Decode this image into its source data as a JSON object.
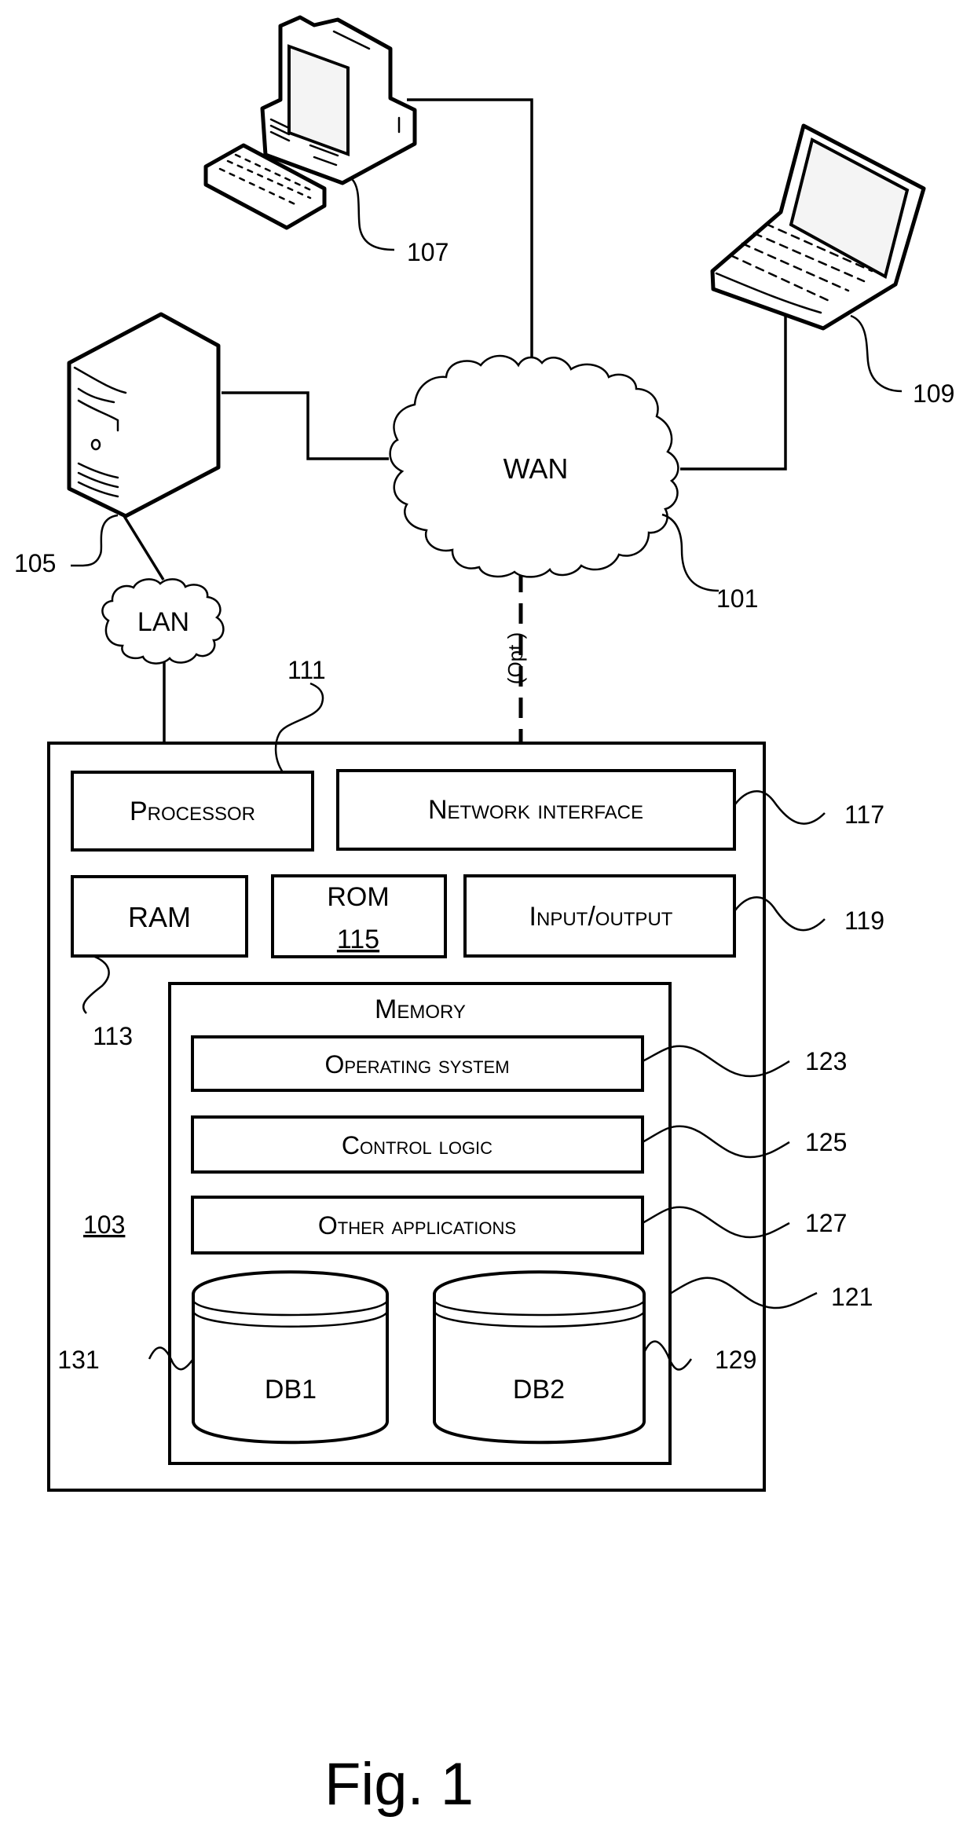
{
  "figure": {
    "caption": "Fig. 1"
  },
  "network": {
    "wan_label": "WAN",
    "wan_ref": "101",
    "lan_label": "LAN",
    "optional_link_label": "(Opt.)"
  },
  "devices": {
    "server_ref": "105",
    "desktop_ref": "107",
    "laptop_ref": "109"
  },
  "computer": {
    "ref": "103",
    "components": {
      "processor": {
        "label": "Processor",
        "ref": "111"
      },
      "network_interface": {
        "label": "Network interface",
        "ref": "117"
      },
      "ram": {
        "label": "RAM",
        "ref": "113"
      },
      "rom": {
        "label": "ROM",
        "ref": "115"
      },
      "input_output": {
        "label": "Input/output",
        "ref": "119"
      }
    },
    "memory": {
      "label": "Memory",
      "ref": "121",
      "items": [
        {
          "label": "Operating system",
          "ref": "123"
        },
        {
          "label": "Control logic",
          "ref": "125"
        },
        {
          "label": "Other applications",
          "ref": "127"
        }
      ],
      "databases": [
        {
          "label": "DB1",
          "ref": "131"
        },
        {
          "label": "DB2",
          "ref": "129"
        }
      ]
    }
  }
}
